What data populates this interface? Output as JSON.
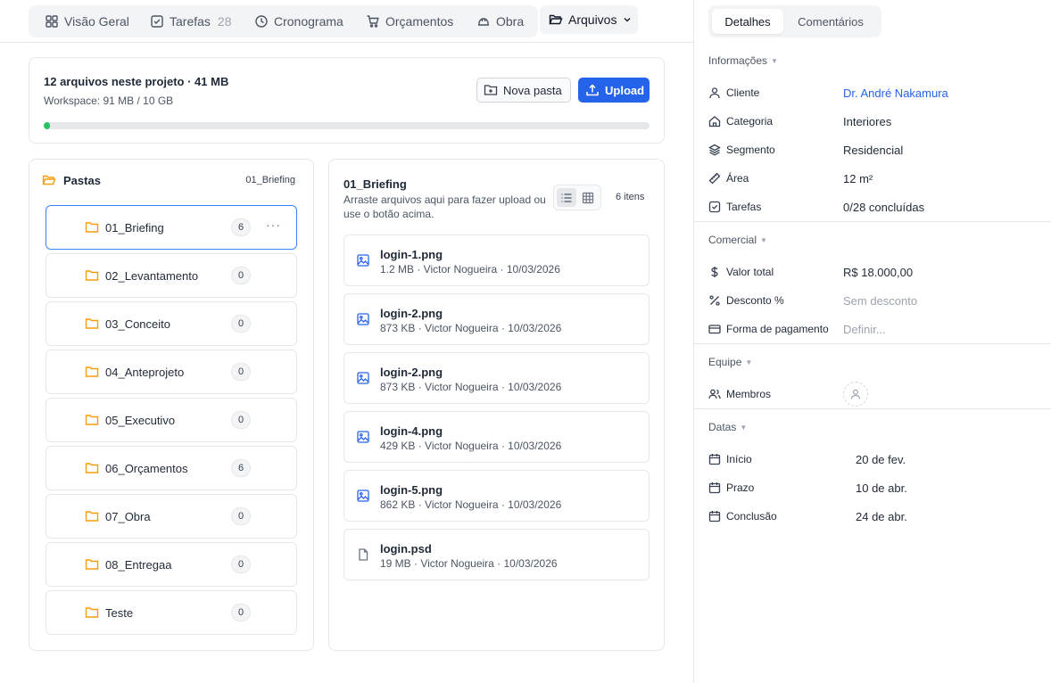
{
  "tabs": [
    {
      "label": "Visão Geral",
      "icon": "grid-icon"
    },
    {
      "label": "Tarefas",
      "count": "28",
      "icon": "checkbox-icon"
    },
    {
      "label": "Cronograma",
      "icon": "clock-icon"
    },
    {
      "label": "Orçamentos",
      "icon": "cart-icon"
    },
    {
      "label": "Obra",
      "icon": "helmet-icon"
    },
    {
      "label": "Arquivos",
      "icon": "folder-open-icon",
      "active": true
    }
  ],
  "summary": {
    "title": "12 arquivos neste projeto · 41 MB",
    "workspace": "Workspace: 91 MB / 10 GB",
    "storage_used_percent": 0.9,
    "new_folder_label": "Nova pasta",
    "upload_label": "Upload"
  },
  "folders": {
    "header": "Pastas",
    "current": "01_Briefing",
    "items": [
      {
        "name": "01_Briefing",
        "count": "6"
      },
      {
        "name": "02_Levantamento",
        "count": "0"
      },
      {
        "name": "03_Conceito",
        "count": "0"
      },
      {
        "name": "04_Anteprojeto",
        "count": "0"
      },
      {
        "name": "05_Executivo",
        "count": "0"
      },
      {
        "name": "06_Orçamentos",
        "count": "6"
      },
      {
        "name": "07_Obra",
        "count": "0"
      },
      {
        "name": "08_Entregaa",
        "count": "0"
      },
      {
        "name": "Teste",
        "count": "0"
      }
    ],
    "more_label": "···"
  },
  "files": {
    "title": "01_Briefing",
    "hint": "Arraste arquivos aqui para fazer upload ou use o botão acima.",
    "count_label": "6 itens",
    "items": [
      {
        "name": "login-1.png",
        "meta": "1.2 MB · Victor Nogueira · 10/03/2026",
        "type": "image"
      },
      {
        "name": "login-2.png",
        "meta": "873 KB · Victor Nogueira · 10/03/2026",
        "type": "image"
      },
      {
        "name": "login-2.png",
        "meta": "873 KB · Victor Nogueira · 10/03/2026",
        "type": "image"
      },
      {
        "name": "login-4.png",
        "meta": "429 KB · Victor Nogueira · 10/03/2026",
        "type": "image"
      },
      {
        "name": "login-5.png",
        "meta": "862 KB · Victor Nogueira · 10/03/2026",
        "type": "image"
      },
      {
        "name": "login.psd",
        "meta": "19 MB · Victor Nogueira · 10/03/2026",
        "type": "file"
      }
    ]
  },
  "sidebar": {
    "tabs": [
      "Detalhes",
      "Comentários"
    ],
    "info": {
      "title": "Informações",
      "client_label": "Cliente",
      "client_value": "Dr. André Nakamura",
      "category_label": "Categoria",
      "category_value": "Interiores",
      "segment_label": "Segmento",
      "segment_value": "Residencial",
      "area_label": "Área",
      "area_value": "12 m²",
      "tasks_label": "Tarefas",
      "tasks_value": "0/28 concluídas"
    },
    "commercial": {
      "title": "Comercial",
      "total_label": "Valor total",
      "total_value": "R$ 18.000,00",
      "discount_label": "Desconto %",
      "discount_value": "Sem desconto",
      "payment_label": "Forma de pagamento",
      "payment_value": "Definir..."
    },
    "team": {
      "title": "Equipe",
      "members_label": "Membros"
    },
    "dates": {
      "title": "Datas",
      "start_label": "Início",
      "start_value": "20 de fev.",
      "deadline_label": "Prazo",
      "deadline_value": "10 de abr.",
      "completion_label": "Conclusão",
      "completion_value": "24 de abr."
    }
  },
  "colors": {
    "accent": "#2563eb",
    "folder": "#f59e0b",
    "progress": "#22c55e",
    "border": "#e5e7eb"
  }
}
